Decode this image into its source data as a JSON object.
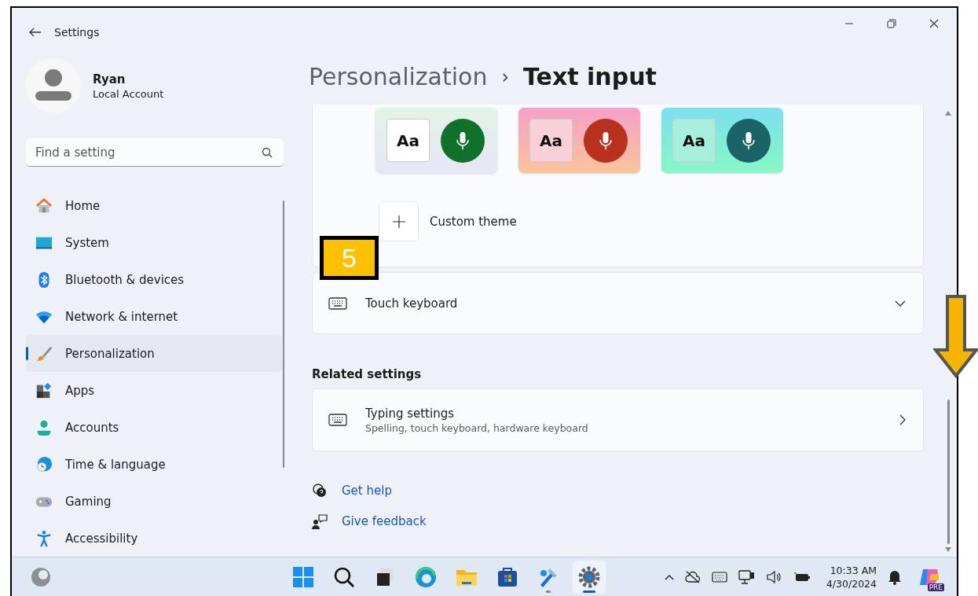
{
  "window": {
    "title": "Settings"
  },
  "profile": {
    "name": "Ryan",
    "account": "Local Account"
  },
  "search": {
    "placeholder": "Find a setting"
  },
  "nav": [
    {
      "label": "Home",
      "kind": "home",
      "selected": false
    },
    {
      "label": "System",
      "kind": "system",
      "selected": false
    },
    {
      "label": "Bluetooth & devices",
      "kind": "bluetooth",
      "selected": false
    },
    {
      "label": "Network & internet",
      "kind": "network",
      "selected": false
    },
    {
      "label": "Personalization",
      "kind": "brush",
      "selected": true
    },
    {
      "label": "Apps",
      "kind": "apps",
      "selected": false
    },
    {
      "label": "Accounts",
      "kind": "accounts",
      "selected": false
    },
    {
      "label": "Time & language",
      "kind": "time",
      "selected": false
    },
    {
      "label": "Gaming",
      "kind": "gaming",
      "selected": false
    },
    {
      "label": "Accessibility",
      "kind": "accessibility",
      "selected": false
    }
  ],
  "breadcrumb": {
    "parent": "Personalization",
    "separator": "›",
    "current": "Text input"
  },
  "themes": [
    {
      "sample": "Aa",
      "color": "#10722a"
    },
    {
      "sample": "Aa",
      "color": "#b8301e"
    },
    {
      "sample": "Aa",
      "color": "#1a6468"
    }
  ],
  "custom_theme": {
    "label": "Custom theme"
  },
  "touch_keyboard": {
    "label": "Touch keyboard",
    "expanded": false
  },
  "callout": {
    "label": "5"
  },
  "related": {
    "heading": "Related settings",
    "items": [
      {
        "title": "Typing settings",
        "subtitle": "Spelling, touch keyboard, hardware keyboard"
      }
    ]
  },
  "links": [
    {
      "label": "Get help",
      "kind": "help"
    },
    {
      "label": "Give feedback",
      "kind": "feedback"
    }
  ],
  "taskbar": {
    "apps": [
      {
        "kind": "start",
        "selected": false,
        "running": false
      },
      {
        "kind": "search",
        "selected": false,
        "running": false
      },
      {
        "kind": "taskview",
        "selected": false,
        "running": false
      },
      {
        "kind": "browser",
        "selected": false,
        "running": false
      },
      {
        "kind": "folder",
        "selected": false,
        "running": false
      },
      {
        "kind": "store",
        "selected": false,
        "running": false
      },
      {
        "kind": "tool",
        "selected": false,
        "running": true
      },
      {
        "kind": "settings",
        "selected": true,
        "running": true
      }
    ],
    "time": "10:33 AM",
    "date": "4/30/2024",
    "copilot_badge": "PRE"
  }
}
